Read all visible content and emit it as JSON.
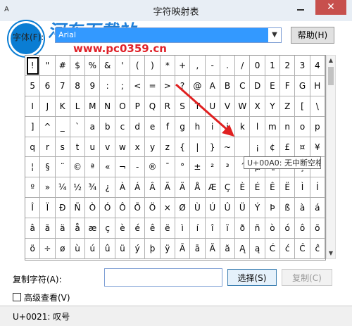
{
  "window": {
    "title": "字符映射表",
    "close_label": "✕",
    "app_icon": "A"
  },
  "watermark": {
    "title": "河东下载站",
    "url": "www.pc0359.cn"
  },
  "font": {
    "label": "字体(F):",
    "selected": "Arial"
  },
  "help_label": "帮助(H)",
  "tooltip": "U+00A0: 无中断空格",
  "copy": {
    "label": "复制字符(A):",
    "value": "",
    "select_label": "选择(S)",
    "copy_label": "复制(C)"
  },
  "advanced_label": "高级查看(V)",
  "status": "U+0021: 叹号",
  "grid": [
    [
      "!",
      "\"",
      "#",
      "$",
      "%",
      "&",
      "'",
      "(",
      ")",
      "*",
      "+",
      ",",
      "-",
      ".",
      "/",
      "0",
      "1",
      "2",
      "3",
      "4"
    ],
    [
      "5",
      "6",
      "7",
      "8",
      "9",
      ":",
      ";",
      "<",
      "=",
      ">",
      "?",
      "@",
      "A",
      "B",
      "C",
      "D",
      "E",
      "F",
      "G",
      "H"
    ],
    [
      "I",
      "J",
      "K",
      "L",
      "M",
      "N",
      "O",
      "P",
      "Q",
      "R",
      "S",
      "T",
      "U",
      "V",
      "W",
      "X",
      "Y",
      "Z",
      "[",
      "\\"
    ],
    [
      "]",
      "^",
      "_",
      "`",
      "a",
      "b",
      "c",
      "d",
      "e",
      "f",
      "g",
      "h",
      "i",
      "j",
      "k",
      "l",
      "m",
      "n",
      "o",
      "p"
    ],
    [
      "q",
      "r",
      "s",
      "t",
      "u",
      "v",
      "w",
      "x",
      "y",
      "z",
      "{",
      "|",
      "}",
      "~",
      "",
      "¡",
      "¢",
      "£",
      "¤",
      "¥"
    ],
    [
      "¦",
      "§",
      "¨",
      "©",
      "ª",
      "«",
      "¬",
      "-",
      "®",
      "¯",
      "°",
      "±",
      "²",
      "³",
      "´",
      "µ",
      "¶",
      "·",
      "¸",
      "¹"
    ],
    [
      "º",
      "»",
      "¼",
      "½",
      "¾",
      "¿",
      "À",
      "Á",
      "Â",
      "Ã",
      "Ä",
      "Å",
      "Æ",
      "Ç",
      "È",
      "É",
      "Ê",
      "Ë",
      "Ì",
      "Í"
    ],
    [
      "Î",
      "Ï",
      "Ð",
      "Ñ",
      "Ò",
      "Ó",
      "Ô",
      "Õ",
      "Ö",
      "×",
      "Ø",
      "Ù",
      "Ú",
      "Û",
      "Ü",
      "Ý",
      "Þ",
      "ß",
      "à",
      "á"
    ],
    [
      "â",
      "ã",
      "ä",
      "å",
      "æ",
      "ç",
      "è",
      "é",
      "ê",
      "ë",
      "ì",
      "í",
      "î",
      "ï",
      "ð",
      "ñ",
      "ò",
      "ó",
      "ô",
      "õ"
    ],
    [
      "ö",
      "÷",
      "ø",
      "ù",
      "ú",
      "û",
      "ü",
      "ý",
      "þ",
      "ÿ",
      "Ā",
      "ā",
      "Ă",
      "ă",
      "Ą",
      "ą",
      "Ć",
      "ć",
      "Ĉ",
      "ĉ"
    ]
  ]
}
